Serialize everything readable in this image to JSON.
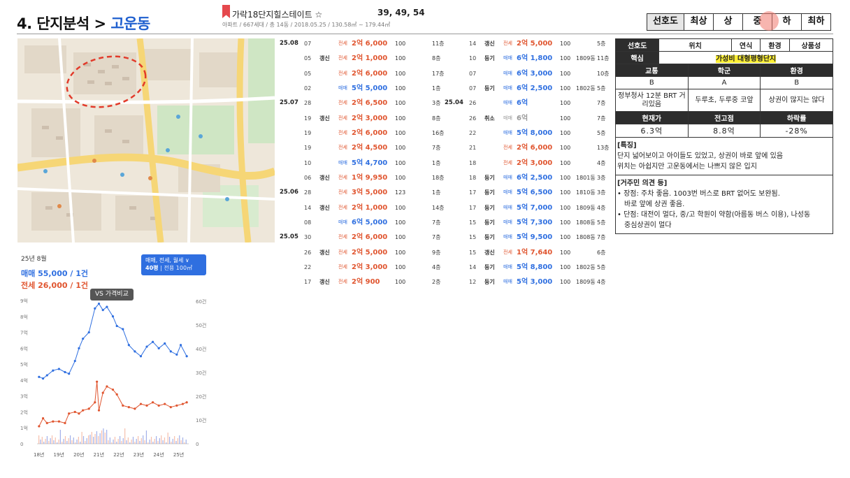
{
  "header": {
    "title_prefix": "4. 단지분석 >",
    "title_location": "고운동",
    "apt_name": "가락18단지힐스테이트 ☆",
    "apt_code": "39, 49, 54",
    "apt_meta": "아파트 / 667세대 / 총 14동 / 2018.05.25 / 130.58㎡ ~ 179.44㎡"
  },
  "grades": [
    "선호도",
    "최상",
    "상",
    "중",
    "하",
    "최하"
  ],
  "graph": {
    "month": "25년 8월",
    "sale_line": "매매 55,000 / 1건",
    "jeonse_line": "전세 26,000 / 1건",
    "filter_line1": "매매, 전세, 월세 ∨",
    "filter_size": "40평",
    "filter_size_detail": "| 전용 100㎡",
    "vs_label": "VS 가격비교",
    "y_left": [
      "9억",
      "8억",
      "7억",
      "6억",
      "5억",
      "4억",
      "3억",
      "2억",
      "1억",
      "0"
    ],
    "y_right": [
      "60건",
      "50건",
      "40건",
      "30건",
      "20건",
      "10건",
      "0"
    ],
    "x_labels": [
      "18년",
      "19년",
      "20년",
      "21년",
      "22년",
      "23년",
      "24년",
      "25년"
    ],
    "colors": {
      "sale": "#2f6fe0",
      "jeonse": "#e0552f",
      "volume_sale": "#7b8fe0",
      "volume_jeonse": "#f2a58a"
    }
  },
  "chart_data": {
    "type": "line",
    "x_range": [
      "18년",
      "25년"
    ],
    "ylim": [
      0,
      9
    ],
    "y2lim": [
      0,
      60
    ],
    "series": [
      {
        "name": "매매",
        "points": [
          [
            2018.1,
            4.2
          ],
          [
            2018.3,
            4.1
          ],
          [
            2018.5,
            4.3
          ],
          [
            2018.8,
            4.6
          ],
          [
            2019.1,
            4.7
          ],
          [
            2019.4,
            4.5
          ],
          [
            2019.6,
            4.4
          ],
          [
            2019.9,
            5.2
          ],
          [
            2020.1,
            6.0
          ],
          [
            2020.3,
            6.6
          ],
          [
            2020.6,
            7.0
          ],
          [
            2020.9,
            8.5
          ],
          [
            2021.1,
            8.8
          ],
          [
            2021.3,
            8.4
          ],
          [
            2021.5,
            8.6
          ],
          [
            2021.8,
            8.0
          ],
          [
            2022.0,
            7.4
          ],
          [
            2022.3,
            7.2
          ],
          [
            2022.6,
            6.2
          ],
          [
            2022.9,
            5.8
          ],
          [
            2023.2,
            5.5
          ],
          [
            2023.5,
            6.1
          ],
          [
            2023.8,
            6.4
          ],
          [
            2024.1,
            6.0
          ],
          [
            2024.4,
            6.3
          ],
          [
            2024.7,
            5.8
          ],
          [
            2025.0,
            5.6
          ],
          [
            2025.2,
            6.2
          ],
          [
            2025.5,
            5.5
          ]
        ]
      },
      {
        "name": "전세",
        "points": [
          [
            2018.1,
            1.1
          ],
          [
            2018.3,
            1.6
          ],
          [
            2018.5,
            1.3
          ],
          [
            2018.8,
            1.4
          ],
          [
            2019.1,
            1.4
          ],
          [
            2019.4,
            1.3
          ],
          [
            2019.6,
            1.9
          ],
          [
            2019.9,
            2.0
          ],
          [
            2020.1,
            1.9
          ],
          [
            2020.3,
            2.1
          ],
          [
            2020.6,
            2.2
          ],
          [
            2020.9,
            2.6
          ],
          [
            2021.0,
            3.9
          ],
          [
            2021.1,
            2.1
          ],
          [
            2021.3,
            3.2
          ],
          [
            2021.5,
            3.6
          ],
          [
            2021.8,
            3.4
          ],
          [
            2022.0,
            3.1
          ],
          [
            2022.3,
            2.4
          ],
          [
            2022.6,
            2.3
          ],
          [
            2022.9,
            2.2
          ],
          [
            2023.2,
            2.5
          ],
          [
            2023.5,
            2.4
          ],
          [
            2023.8,
            2.6
          ],
          [
            2024.1,
            2.4
          ],
          [
            2024.4,
            2.5
          ],
          [
            2024.7,
            2.3
          ],
          [
            2025.0,
            2.4
          ],
          [
            2025.3,
            2.5
          ],
          [
            2025.5,
            2.6
          ]
        ]
      }
    ]
  },
  "trades_left": [
    {
      "ym": "25.08",
      "day": "07",
      "tag": "",
      "type": "전세",
      "price": "2억 6,000",
      "kind": "jeonse",
      "area": "100",
      "dong": "",
      "floor": "11층"
    },
    {
      "ym": "",
      "day": "05",
      "tag": "갱신",
      "type": "전세",
      "price": "2억 1,000",
      "kind": "jeonse",
      "area": "100",
      "dong": "",
      "floor": "8층"
    },
    {
      "ym": "",
      "day": "05",
      "tag": "",
      "type": "전세",
      "price": "2억 6,000",
      "kind": "jeonse",
      "area": "100",
      "dong": "",
      "floor": "17층"
    },
    {
      "ym": "",
      "day": "02",
      "tag": "",
      "type": "매매",
      "price": "5억 5,000",
      "kind": "sale",
      "area": "100",
      "dong": "",
      "floor": "1층"
    },
    {
      "ym": "25.07",
      "day": "28",
      "tag": "",
      "type": "전세",
      "price": "2억 6,500",
      "kind": "jeonse",
      "area": "100",
      "dong": "",
      "floor": "3층"
    },
    {
      "ym": "",
      "day": "19",
      "tag": "갱신",
      "type": "전세",
      "price": "2억 3,000",
      "kind": "jeonse",
      "area": "100",
      "dong": "",
      "floor": "8층"
    },
    {
      "ym": "",
      "day": "19",
      "tag": "",
      "type": "전세",
      "price": "2억 6,000",
      "kind": "jeonse",
      "area": "100",
      "dong": "",
      "floor": "16층"
    },
    {
      "ym": "",
      "day": "19",
      "tag": "",
      "type": "전세",
      "price": "2억 4,500",
      "kind": "jeonse",
      "area": "100",
      "dong": "",
      "floor": "7층"
    },
    {
      "ym": "",
      "day": "10",
      "tag": "",
      "type": "매매",
      "price": "5억 4,700",
      "kind": "sale",
      "area": "100",
      "dong": "",
      "floor": "1층"
    },
    {
      "ym": "",
      "day": "06",
      "tag": "갱신",
      "type": "전세",
      "price": "1억 9,950",
      "kind": "jeonse",
      "area": "100",
      "dong": "",
      "floor": "18층"
    },
    {
      "ym": "25.06",
      "day": "28",
      "tag": "",
      "type": "전세",
      "price": "3억 5,000",
      "kind": "jeonse",
      "area": "123",
      "dong": "",
      "floor": "1층"
    },
    {
      "ym": "",
      "day": "14",
      "tag": "갱신",
      "type": "전세",
      "price": "2억 1,000",
      "kind": "jeonse",
      "area": "100",
      "dong": "",
      "floor": "14층"
    },
    {
      "ym": "",
      "day": "08",
      "tag": "",
      "type": "매매",
      "price": "6억 5,000",
      "kind": "sale",
      "area": "100",
      "dong": "",
      "floor": "7층"
    },
    {
      "ym": "25.05",
      "day": "30",
      "tag": "",
      "type": "전세",
      "price": "2억 6,000",
      "kind": "jeonse",
      "area": "100",
      "dong": "",
      "floor": "7층"
    },
    {
      "ym": "",
      "day": "26",
      "tag": "갱신",
      "type": "전세",
      "price": "2억 5,000",
      "kind": "jeonse",
      "area": "100",
      "dong": "",
      "floor": "9층"
    },
    {
      "ym": "",
      "day": "22",
      "tag": "",
      "type": "전세",
      "price": "2억 3,000",
      "kind": "jeonse",
      "area": "100",
      "dong": "",
      "floor": "4층"
    },
    {
      "ym": "",
      "day": "17",
      "tag": "갱신",
      "type": "전세",
      "price": "2억 900",
      "kind": "jeonse",
      "area": "100",
      "dong": "",
      "floor": "2층"
    }
  ],
  "trades_right": [
    {
      "ym": "",
      "day": "14",
      "tag": "갱신",
      "type": "전세",
      "price": "2억 5,000",
      "kind": "jeonse",
      "area": "100",
      "dong": "",
      "floor": "5층"
    },
    {
      "ym": "",
      "day": "10",
      "tag": "등기",
      "type": "매매",
      "price": "6억 1,800",
      "kind": "sale",
      "area": "100",
      "dong": "1809동",
      "floor": "11층"
    },
    {
      "ym": "",
      "day": "07",
      "tag": "",
      "type": "매매",
      "price": "6억 3,000",
      "kind": "sale",
      "area": "100",
      "dong": "",
      "floor": "10층"
    },
    {
      "ym": "",
      "day": "07",
      "tag": "등기",
      "type": "매매",
      "price": "6억 2,500",
      "kind": "sale",
      "area": "100",
      "dong": "1802동",
      "floor": "5층"
    },
    {
      "ym": "25.04",
      "day": "26",
      "tag": "",
      "type": "매매",
      "price": "6억",
      "kind": "sale",
      "area": "100",
      "dong": "",
      "floor": "7층"
    },
    {
      "ym": "",
      "day": "26",
      "tag": "취소",
      "type": "매매",
      "price": "6억",
      "kind": "cancel",
      "area": "100",
      "dong": "",
      "floor": "7층"
    },
    {
      "ym": "",
      "day": "22",
      "tag": "",
      "type": "매매",
      "price": "5억 8,000",
      "kind": "sale",
      "area": "100",
      "dong": "",
      "floor": "5층"
    },
    {
      "ym": "",
      "day": "21",
      "tag": "",
      "type": "전세",
      "price": "2억 6,000",
      "kind": "jeonse",
      "area": "100",
      "dong": "",
      "floor": "13층"
    },
    {
      "ym": "",
      "day": "18",
      "tag": "",
      "type": "전세",
      "price": "2억 3,000",
      "kind": "jeonse",
      "area": "100",
      "dong": "",
      "floor": "4층"
    },
    {
      "ym": "",
      "day": "18",
      "tag": "등기",
      "type": "매매",
      "price": "6억 2,500",
      "kind": "sale",
      "area": "100",
      "dong": "1801동",
      "floor": "3층"
    },
    {
      "ym": "",
      "day": "17",
      "tag": "등기",
      "type": "매매",
      "price": "5억 6,500",
      "kind": "sale",
      "area": "100",
      "dong": "1810동",
      "floor": "3층"
    },
    {
      "ym": "",
      "day": "17",
      "tag": "등기",
      "type": "매매",
      "price": "5억 7,000",
      "kind": "sale",
      "area": "100",
      "dong": "1809동",
      "floor": "4층"
    },
    {
      "ym": "",
      "day": "15",
      "tag": "등기",
      "type": "매매",
      "price": "5억 7,300",
      "kind": "sale",
      "area": "100",
      "dong": "1808동",
      "floor": "5층"
    },
    {
      "ym": "",
      "day": "15",
      "tag": "등기",
      "type": "매매",
      "price": "5억 9,500",
      "kind": "sale",
      "area": "100",
      "dong": "1808동",
      "floor": "7층"
    },
    {
      "ym": "",
      "day": "15",
      "tag": "갱신",
      "type": "전세",
      "price": "1억 7,640",
      "kind": "jeonse",
      "area": "100",
      "dong": "",
      "floor": "6층"
    },
    {
      "ym": "",
      "day": "14",
      "tag": "등기",
      "type": "매매",
      "price": "5억 8,800",
      "kind": "sale",
      "area": "100",
      "dong": "1802동",
      "floor": "5층"
    },
    {
      "ym": "",
      "day": "12",
      "tag": "등기",
      "type": "매매",
      "price": "5억 3,000",
      "kind": "sale",
      "area": "100",
      "dong": "1809동",
      "floor": "4층"
    }
  ],
  "analysis": {
    "row1": [
      "선호도",
      "위치",
      "연식",
      "환경",
      "상품성"
    ],
    "core_label": "핵심",
    "core_value": "가성비 대형평형단지",
    "row3": [
      "교통",
      "학군",
      "환경"
    ],
    "row4": [
      "B",
      "A",
      "B"
    ],
    "row5": [
      "정부청사 12분 BRT 거리있음",
      "두루초, 두루중 코앞",
      "상권이 많지는 않다"
    ],
    "row6": [
      "현재가",
      "전고점",
      "하락률"
    ],
    "row7": [
      "6.3억",
      "8.8억",
      "-28%"
    ],
    "feature_title": "[특징]",
    "feature_lines": [
      "단지 넓어보이고 아이들도 있었고, 상권이 바로 앞에 있음",
      "위치는 아쉽지만 고운동에서는 나쁘지 않은 입지"
    ],
    "opinion_title": "[거주민 의견 등]",
    "opinion_lines": [
      "• 장점: 주차 좋음. 1003번 버스로 BRT 없어도 보완됨.",
      "바로 앞에 상권 좋음.",
      "• 단점: 대전이 멀다, 중/고 학원이 약함(아름동 버스 이용), 나성동",
      "중심상권이 멀다"
    ]
  }
}
